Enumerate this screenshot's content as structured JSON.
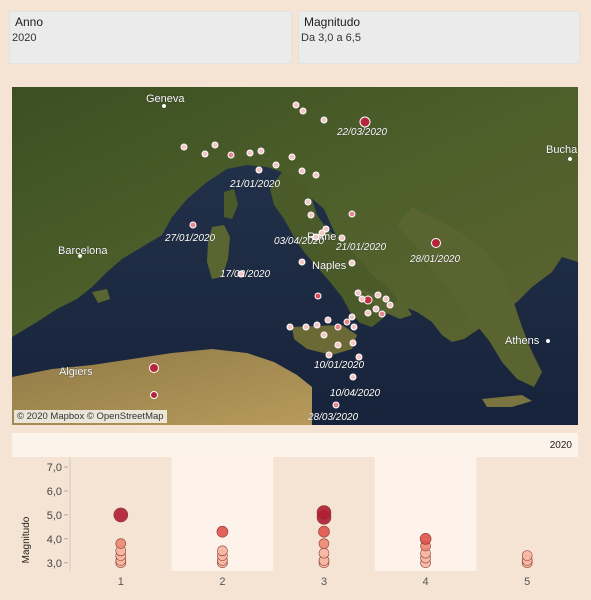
{
  "filters": {
    "anno": {
      "label": "Anno",
      "value": "2020"
    },
    "magnitudo": {
      "label": "Magnitudo",
      "value": "Da 3,0 a 6,5"
    }
  },
  "map": {
    "credit": "© 2020 Mapbox © OpenStreetMap",
    "places": [
      "Geneva",
      "Buchar",
      "Barcelona",
      "Rome",
      "Naples",
      "Athens",
      "Algiers"
    ],
    "date_labels": [
      "22/03/2020",
      "21/01/2020",
      "27/01/2020",
      "03/04/2020",
      "21/01/2020",
      "28/01/2020",
      "17/02/2020",
      "10/01/2020",
      "10/04/2020",
      "28/03/2020"
    ],
    "colors": {
      "strong": "#b5263d",
      "medium": "#e9858f",
      "weak": "#f5c6c6",
      "stroke": "#ffffff"
    }
  },
  "chart_header": {
    "year": "2020"
  },
  "chart_data": {
    "type": "scatter",
    "title": "",
    "xlabel": "",
    "ylabel": "Magnitudo",
    "categories": [
      "1",
      "2",
      "3",
      "4",
      "5"
    ],
    "ylim": [
      2.7,
      7.0
    ],
    "yticks": [
      "3,0",
      "4,0",
      "5,0",
      "6,0",
      "7,0"
    ],
    "points": [
      {
        "x": "1",
        "y": 5.0
      },
      {
        "x": "1",
        "y": 3.8
      },
      {
        "x": "1",
        "y": 3.5
      },
      {
        "x": "1",
        "y": 3.3
      },
      {
        "x": "1",
        "y": 3.1
      },
      {
        "x": "1",
        "y": 3.0
      },
      {
        "x": "2",
        "y": 4.3
      },
      {
        "x": "2",
        "y": 3.5
      },
      {
        "x": "2",
        "y": 3.3
      },
      {
        "x": "2",
        "y": 3.1
      },
      {
        "x": "2",
        "y": 3.0
      },
      {
        "x": "3",
        "y": 5.1
      },
      {
        "x": "3",
        "y": 4.9
      },
      {
        "x": "3",
        "y": 4.3
      },
      {
        "x": "3",
        "y": 3.8
      },
      {
        "x": "3",
        "y": 3.4
      },
      {
        "x": "3",
        "y": 3.1
      },
      {
        "x": "3",
        "y": 3.0
      },
      {
        "x": "4",
        "y": 4.0
      },
      {
        "x": "4",
        "y": 3.7
      },
      {
        "x": "4",
        "y": 3.4
      },
      {
        "x": "4",
        "y": 3.2
      },
      {
        "x": "4",
        "y": 3.0
      },
      {
        "x": "5",
        "y": 3.3
      },
      {
        "x": "5",
        "y": 3.1
      },
      {
        "x": "5",
        "y": 3.0
      }
    ],
    "shaded_bands": [
      "2",
      "4"
    ],
    "colors": {
      "low": "#f7b7a2",
      "mid": "#e2564f",
      "high": "#b11f35",
      "band": "#fdf3ea"
    }
  }
}
